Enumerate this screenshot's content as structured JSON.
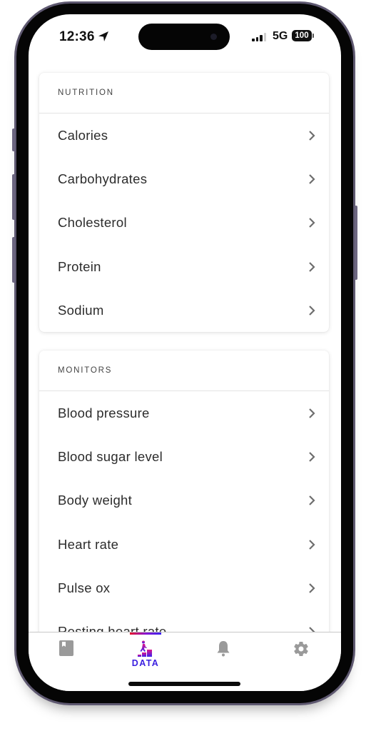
{
  "status_bar": {
    "time": "12:36",
    "network": "5G",
    "battery": "100"
  },
  "sections": [
    {
      "title": "NUTRITION",
      "items": [
        {
          "label": "Calories"
        },
        {
          "label": "Carbohydrates"
        },
        {
          "label": "Cholesterol"
        },
        {
          "label": "Protein"
        },
        {
          "label": "Sodium"
        }
      ]
    },
    {
      "title": "MONITORS",
      "items": [
        {
          "label": "Blood pressure"
        },
        {
          "label": "Blood sugar level"
        },
        {
          "label": "Body weight"
        },
        {
          "label": "Heart rate"
        },
        {
          "label": "Pulse ox"
        },
        {
          "label": "Resting heart rate"
        }
      ]
    }
  ],
  "tabbar": {
    "tabs": [
      {
        "icon": "journal-icon",
        "label": ""
      },
      {
        "icon": "data-chart-icon",
        "label": "DATA",
        "active": true
      },
      {
        "icon": "bell-icon",
        "label": ""
      },
      {
        "icon": "gear-icon",
        "label": ""
      }
    ]
  },
  "colors": {
    "active_tab": "#3a1fe0",
    "indicator_start": "#e8102a",
    "indicator_end": "#3b22f0",
    "inactive_icon": "#9a9a9a"
  }
}
